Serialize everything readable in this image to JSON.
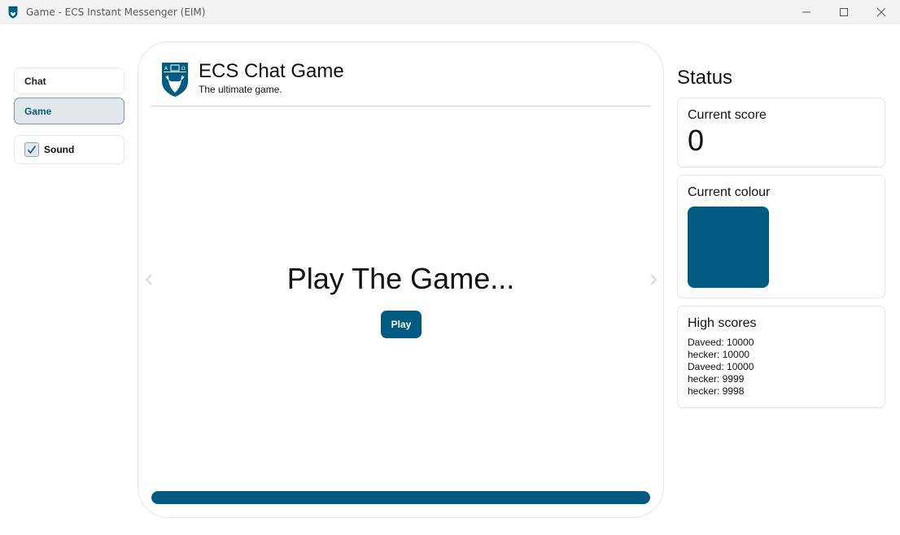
{
  "window": {
    "title": "Game - ECS Instant Messenger (EIM)",
    "controls": [
      "minimize",
      "maximize",
      "close"
    ]
  },
  "sidebar": {
    "items": [
      {
        "label": "Chat",
        "active": false
      },
      {
        "label": "Game",
        "active": true
      }
    ],
    "sound": {
      "label": "Sound",
      "checked": true
    }
  },
  "game": {
    "title": "ECS Chat Game",
    "subtitle": "The ultimate game.",
    "heading": "Play The Game...",
    "play_label": "Play",
    "progress_percent": 100,
    "icons": {
      "prev": "chevron-left-icon",
      "next": "chevron-right-icon",
      "logo": "shield-logo-icon"
    }
  },
  "status": {
    "heading": "Status",
    "current_score": {
      "label": "Current score",
      "value": "0"
    },
    "current_colour": {
      "label": "Current colour",
      "value": "#005a82"
    },
    "high_scores": {
      "label": "High scores",
      "entries": [
        "Daveed: 10000",
        "hecker: 10000",
        "Daveed: 10000",
        "hecker: 9999",
        "hecker: 9998"
      ]
    }
  },
  "colors": {
    "accent": "#005a82",
    "active_nav_bg": "#e1e7eb",
    "border": "#e1e7ea"
  }
}
